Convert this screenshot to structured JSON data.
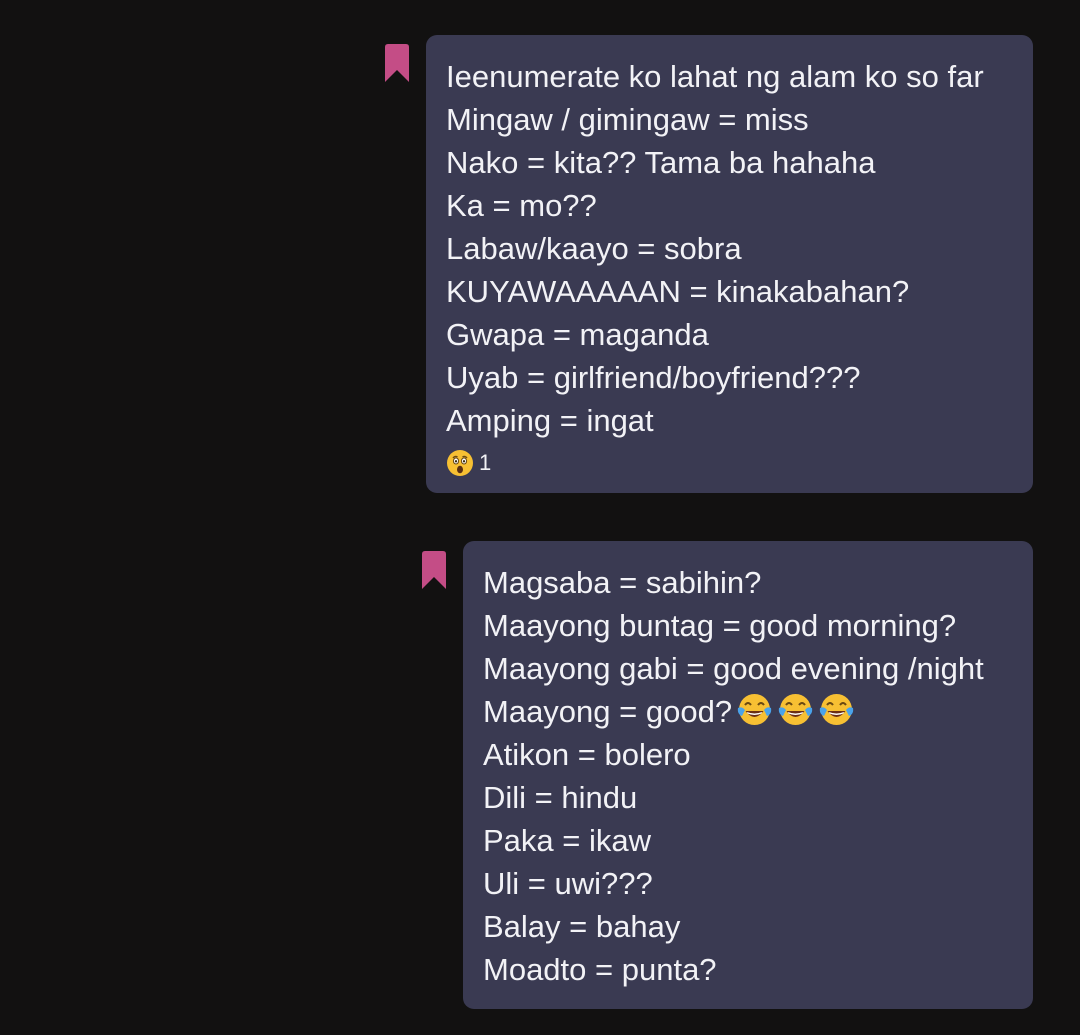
{
  "colors": {
    "background": "#121111",
    "bubble": "#3a3a52",
    "text": "#f2f2f6",
    "bookmark": "#c44d86",
    "emoji_face": "#f7c033"
  },
  "messages": [
    {
      "bookmark_icon": "bookmark-icon",
      "lines": [
        "Ieenumerate ko lahat ng alam ko so far",
        "Mingaw / gimingaw = miss",
        "Nako = kita?? Tama ba hahaha",
        "Ka = mo??",
        "Labaw/kaayo = sobra",
        "KUYAWAAAAAN = kinakabahan?",
        "Gwapa = maganda",
        "Uyab = girlfriend/boyfriend???",
        "Amping = ingat"
      ],
      "reaction": {
        "icon": "astonished-face-icon",
        "count": "1"
      }
    },
    {
      "bookmark_icon": "bookmark-icon",
      "lines": [
        "Magsaba = sabihin?",
        "Maayong buntag = good morning?",
        "Maayong gabi = good evening /night",
        "Maayong = good?",
        "Atikon = bolero",
        "Dili = hindu",
        "Paka = ikaw",
        "Uli = uwi???",
        "Balay = bahay",
        "Moadto = punta?"
      ],
      "emoji_after_line_4": [
        "face-with-tears-of-joy-icon",
        "face-with-tears-of-joy-icon",
        "face-with-tears-of-joy-icon"
      ]
    }
  ]
}
